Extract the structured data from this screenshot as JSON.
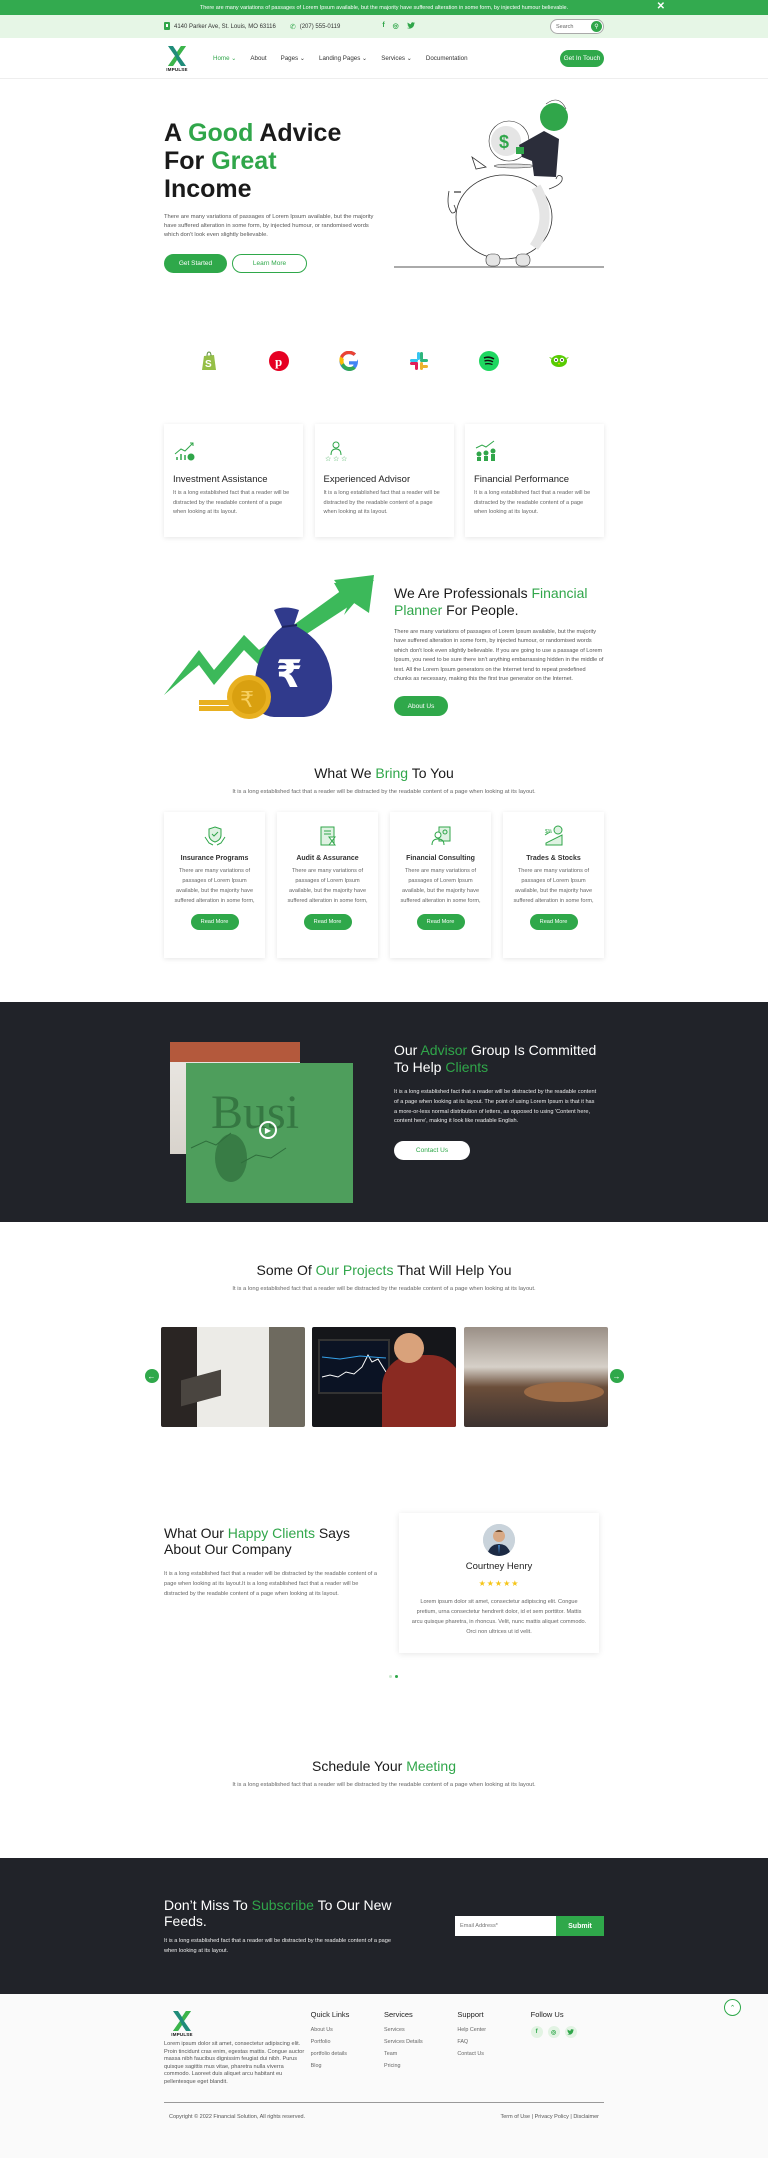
{
  "announcement": {
    "text": "There are many variations of passages of Lorem Ipsum available, but the majority have suffered alteration in some form, by injected humour believable.",
    "close": "✕"
  },
  "topbar": {
    "address": "4140 Parker Ave, St. Louis, MO 63116",
    "phone": "(207) 555-0119",
    "socials": [
      "f",
      "◎",
      "🐦"
    ],
    "search_placeholder": "Search"
  },
  "brand": {
    "name": "IMPULSE",
    "primary_color": "#30a64a",
    "dark_color": "#212329"
  },
  "nav": {
    "items": [
      {
        "label": "Home ⌄",
        "active": true
      },
      {
        "label": "About"
      },
      {
        "label": "Pages ⌄"
      },
      {
        "label": "Landing Pages ⌄"
      },
      {
        "label": "Services ⌄"
      },
      {
        "label": "Documentation"
      }
    ],
    "cta": "Get In Touch"
  },
  "hero": {
    "title_1": "A ",
    "title_2": "Good",
    "title_3": " Advice",
    "title_4": "For ",
    "title_5": "Great",
    "title_6": "Income",
    "text": "There are many variations of passages of Lorem Ipsum available, but the majority have suffered alteration in some form, by injected humour, or randomised words which don't look even slightly believable.",
    "primary_btn": "Get Started",
    "secondary_btn": "Learn More"
  },
  "brands": [
    "shopify",
    "pinterest",
    "google",
    "slack",
    "spotify",
    "duolingo"
  ],
  "features": [
    {
      "icon": "investment-chart-icon",
      "title": "Investment Assistance",
      "text": "It is a long established fact that a reader will be distracted by the readable content of a page when looking at its layout."
    },
    {
      "icon": "advisor-icon",
      "title": "Experienced Advisor",
      "text": "It is a long established fact that a reader will be distracted by the readable content of a page when looking at its layout."
    },
    {
      "icon": "performance-icon",
      "title": "Financial Performance",
      "text": "It is a long established fact that a reader will be distracted by the readable content of a page when looking at its layout."
    }
  ],
  "pro": {
    "title_1": "We Are Professionals ",
    "title_2": "Financial Planner",
    "title_3": " For People.",
    "text": "There are many variations of passages of Lorem Ipsum available, but the majority have suffered alteration in some form, by injected humour, or randomised words which don't look even slightly believable. If you are going to use a passage of Lorem Ipsum, you need to be sure there isn't anything embarrassing hidden in the middle of text. All the Lorem Ipsum generators on the Internet tend to repeat predefined chunks as necessary, making this the first true generator on the Internet.",
    "button": "About Us"
  },
  "bring": {
    "title_1": "What We ",
    "title_2": "Bring",
    "title_3": " To You",
    "subtitle": "It is a long established fact that a reader will be distracted by the readable content of a page when looking at its layout.",
    "cards": [
      {
        "title": "Insurance Programs",
        "text": "There are many variations of passages of Lorem Ipsum available, but the majority have suffered alteration in some form,",
        "button": "Read More"
      },
      {
        "title": "Audit & Assurance",
        "text": "There are many variations of passages of Lorem Ipsum available, but the majority have suffered alteration in some form,",
        "button": "Read More"
      },
      {
        "title": "Financial Consulting",
        "text": "There are many variations of passages of Lorem Ipsum available, but the majority have suffered alteration in some form,",
        "button": "Read More"
      },
      {
        "title": "Trades & Stocks",
        "text": "There are many variations of passages of Lorem Ipsum available, but the majority have suffered alteration in some form,",
        "button": "Read More"
      }
    ]
  },
  "advisor": {
    "title_1": "Our ",
    "title_2": "Advisor",
    "title_3": " Group Is Committed To Help ",
    "title_4": "Clients",
    "text": "It is a long established fact that a reader will be distracted by the readable content of a page when looking at its layout. The point of using Lorem Ipsum is that it has a more-or-less normal distribution of letters, as opposed to using 'Content here, content here', making it look like readable English.",
    "button": "Contact Us",
    "image_word": "Busi"
  },
  "projects": {
    "title_1": "Some Of ",
    "title_2": "Our Projects",
    "title_3": " That Will Help You",
    "subtitle": "It is a long established fact that a reader will be distracted by the readable content of a page when looking at its layout.",
    "prev": "←",
    "next": "→"
  },
  "testimonials": {
    "title_1": "What Our ",
    "title_2": "Happy Clients",
    "title_3": " Says About Our Company",
    "text": "It is a long established fact that a reader will be distracted by the readable content of a page when looking at its layout.It is a long established fact that a reader will be distracted by the readable content of a page when looking at its layout.",
    "name": "Courtney Henry",
    "rating": 5,
    "stars": "★★★★★",
    "quote": "Lorem ipsum dolor sit amet, consectetur adipiscing elit. Congue pretium, urna consectetur hendrerit dolor, id et sem porttitor. Mattis arcu quisque pharetra, in rhoncus. Velit, nunc mattis aliquet commodo. Orci non ultrices ut id velit.",
    "active_slide": 2,
    "total_slides": 2
  },
  "schedule": {
    "title_1": "Schedule Your ",
    "title_2": "Meeting",
    "subtitle": "It is a long established fact that a reader will be distracted by the readable content of a page when looking at its layout."
  },
  "subscribe": {
    "title_1": "Don’t Miss To ",
    "title_2": "Subscribe",
    "title_3": " To Our New Feeds.",
    "text": "It is a long established fact that a reader will be distracted by the readable content of a page when looking at its layout.",
    "placeholder": "Email Address*",
    "button": "Submit"
  },
  "footer": {
    "about": "Lorem ipsum dolor sit amet, consectetur adipiscing elit. Proin tincidunt cras enim, egestas mattis. Congue auctor massa nibh faucibus dignissim feugiat dui nibh. Purus quisque sagittis mus vitae, pharetra nulla viverra commodo. Laoreet duis aliquet arcu habitant eu pellentesque eget blandit.",
    "cols": [
      {
        "title": "Quick Links",
        "links": [
          "About Us",
          "Portfolio",
          "portfolio details",
          "Blog"
        ]
      },
      {
        "title": "Services",
        "links": [
          "Services",
          "Services Details",
          "Team",
          "Pricing"
        ]
      },
      {
        "title": "Support",
        "links": [
          "Help Center",
          "FAQ",
          "Contact Us"
        ]
      }
    ],
    "follow_title": "Follow Us",
    "follow": [
      "f",
      "◎",
      "🐦"
    ],
    "copyright": "Copyright © 2022 Financial Solution, All rights reserved.",
    "legal": [
      "Term of Use",
      "Privacy Policy",
      "Disclaimer"
    ],
    "to_top": "⌃"
  }
}
